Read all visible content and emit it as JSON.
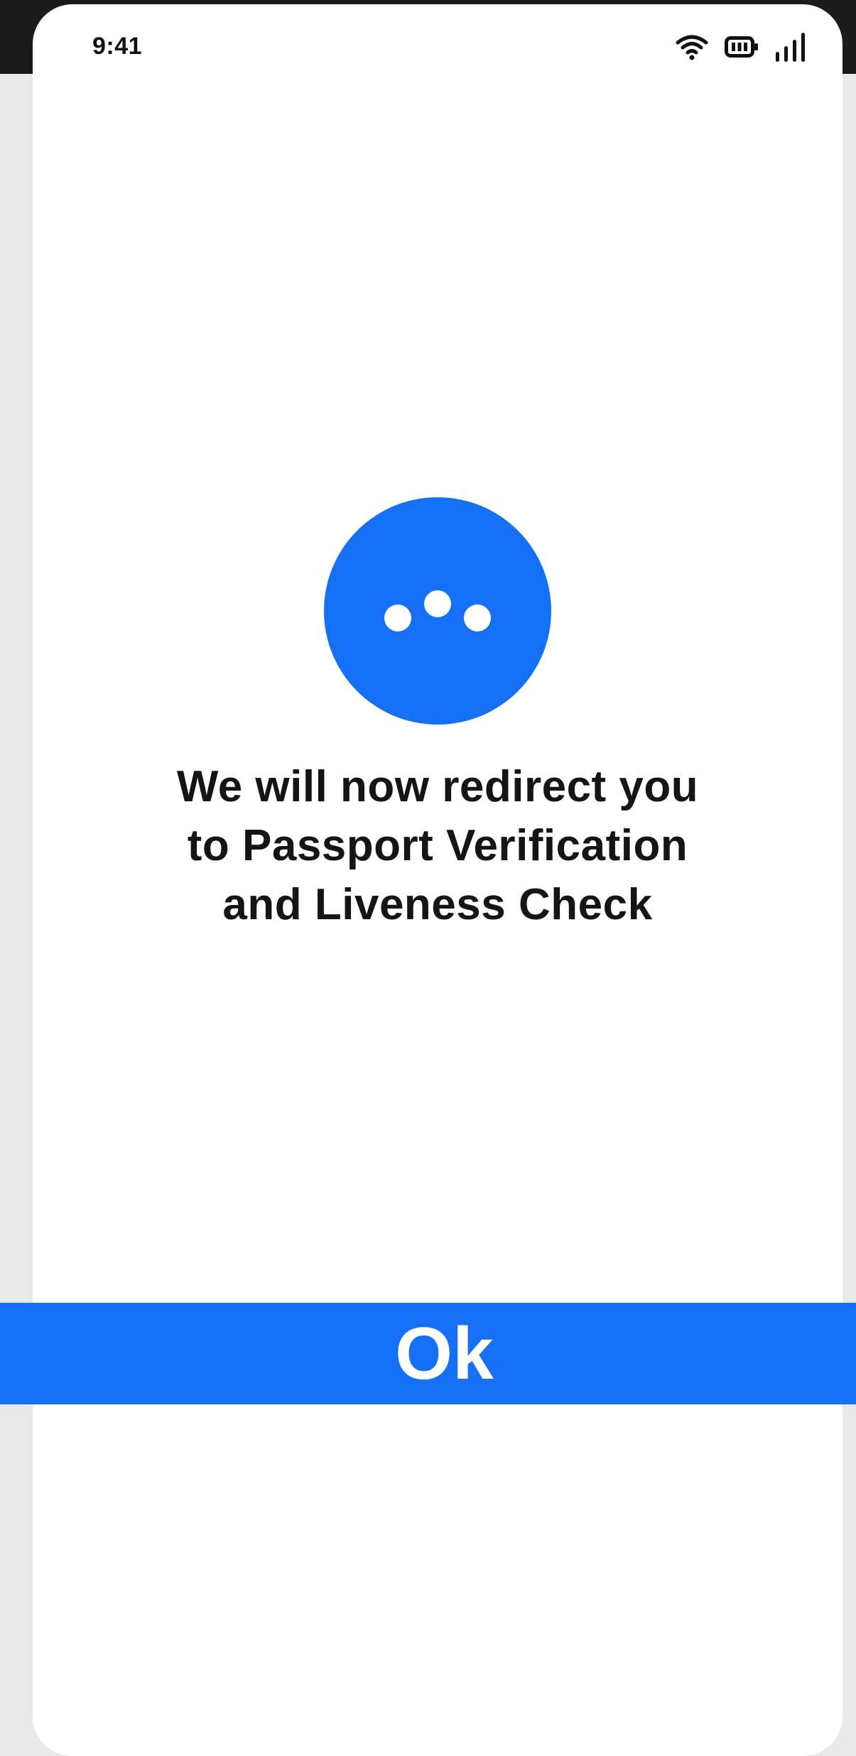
{
  "status_bar": {
    "time": "9:41",
    "icons": [
      "wifi-icon",
      "battery-icon",
      "cellular-signal-icon"
    ]
  },
  "loader": {
    "icon": "loading-dots-icon",
    "color": "#1570f5"
  },
  "message": {
    "line1": "We will now redirect you",
    "line2": "to Passport Verification",
    "line3": "and Liveness Check"
  },
  "ok_button": {
    "label": "Ok",
    "color": "#1570f5"
  }
}
